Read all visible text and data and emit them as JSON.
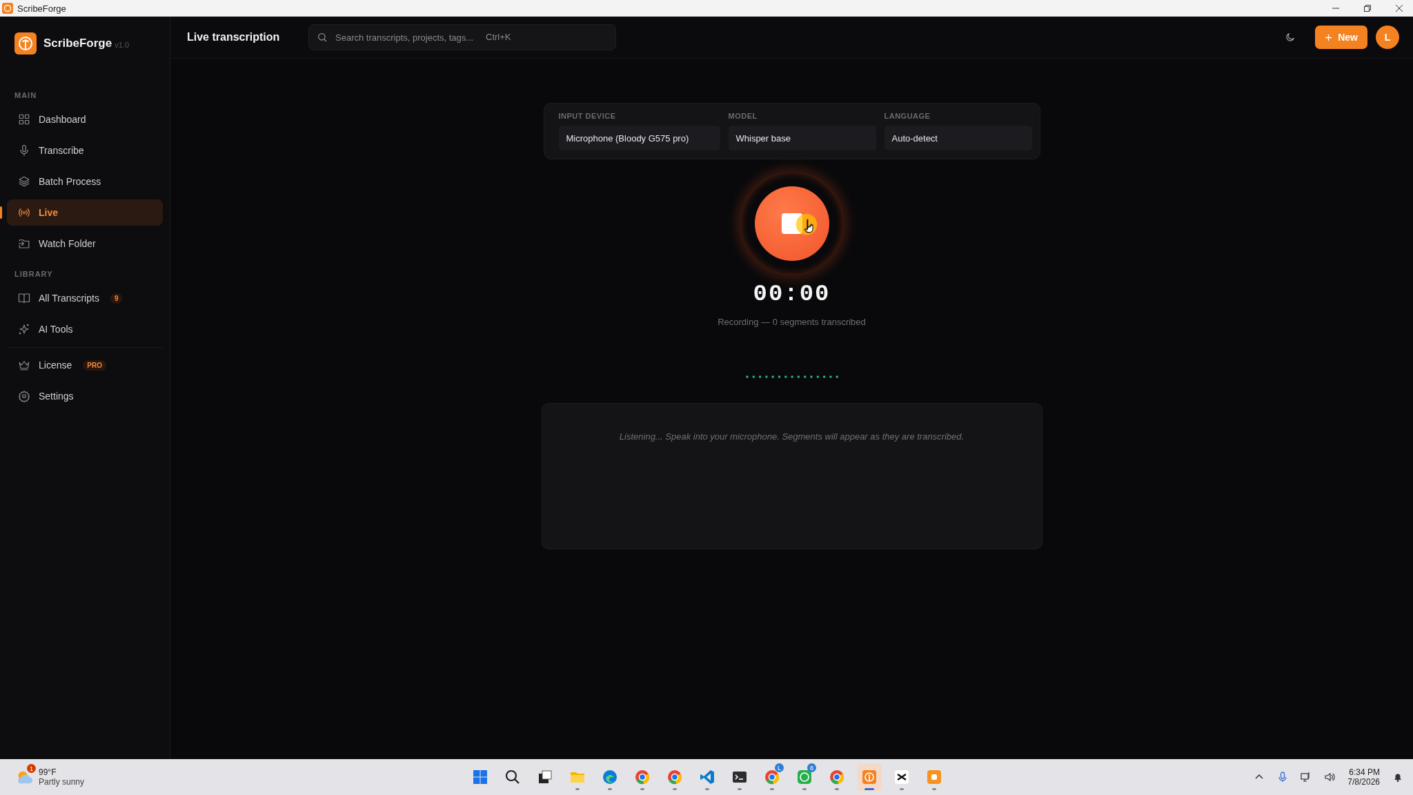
{
  "window": {
    "title": "ScribeForge"
  },
  "sidebar": {
    "brand": "ScribeForge",
    "version": "v1.0",
    "sections": [
      {
        "title": "MAIN",
        "items": [
          {
            "label": "Dashboard",
            "selected": false
          },
          {
            "label": "Transcribe",
            "selected": false
          },
          {
            "label": "Batch Process",
            "selected": false
          },
          {
            "label": "Live",
            "selected": true
          },
          {
            "label": "Watch Folder",
            "selected": false
          }
        ]
      },
      {
        "title": "LIBRARY",
        "items": [
          {
            "label": "All Transcripts",
            "selected": false,
            "badge": "9"
          },
          {
            "label": "AI Tools",
            "selected": false
          }
        ]
      }
    ],
    "footer_items": [
      {
        "label": "License",
        "selected": false,
        "badge": "PRO"
      },
      {
        "label": "Settings",
        "selected": false
      }
    ]
  },
  "topbar": {
    "title": "Live transcription",
    "search": {
      "placeholder": "Search transcripts, projects, tags...",
      "shortcut": "Ctrl+K"
    },
    "new_button": "New",
    "avatar": "L"
  },
  "config": [
    {
      "label": "INPUT DEVICE",
      "value": "Microphone (Bloody G575 pro)"
    },
    {
      "label": "MODEL",
      "value": "Whisper base"
    },
    {
      "label": "LANGUAGE",
      "value": "Auto-detect"
    }
  ],
  "recorder": {
    "recording": true,
    "timer": "00:00",
    "status": "Recording — 0 segments transcribed"
  },
  "transcript": {
    "empty_message": "Listening... Speak into your microphone. Segments will appear as they are transcribed."
  },
  "taskbar": {
    "weather": {
      "temperature": "99°F",
      "condition": "Partly sunny",
      "badge": "1"
    },
    "apps": [
      {
        "kind": "start",
        "running": false,
        "selected": false
      },
      {
        "kind": "search",
        "running": false,
        "selected": false
      },
      {
        "kind": "taskview",
        "running": false,
        "selected": false
      },
      {
        "kind": "folder",
        "running": true,
        "selected": false
      },
      {
        "kind": "wave",
        "running": true,
        "selected": false
      },
      {
        "kind": "browser",
        "running": true,
        "selected": false
      },
      {
        "kind": "browser",
        "running": true,
        "selected": false
      },
      {
        "kind": "editor",
        "running": true,
        "selected": false
      },
      {
        "kind": "terminal",
        "running": true,
        "selected": false
      },
      {
        "kind": "browser",
        "running": true,
        "selected": false,
        "badge": "L"
      },
      {
        "kind": "chat",
        "running": true,
        "selected": false,
        "badge": "8"
      },
      {
        "kind": "browser",
        "running": true,
        "selected": false
      },
      {
        "kind": "logo",
        "running": true,
        "selected": true
      },
      {
        "kind": "scissors",
        "running": true,
        "selected": false
      },
      {
        "kind": "square",
        "running": true,
        "selected": false
      }
    ],
    "time": "6:34 PM",
    "date": "7/8/2026"
  }
}
